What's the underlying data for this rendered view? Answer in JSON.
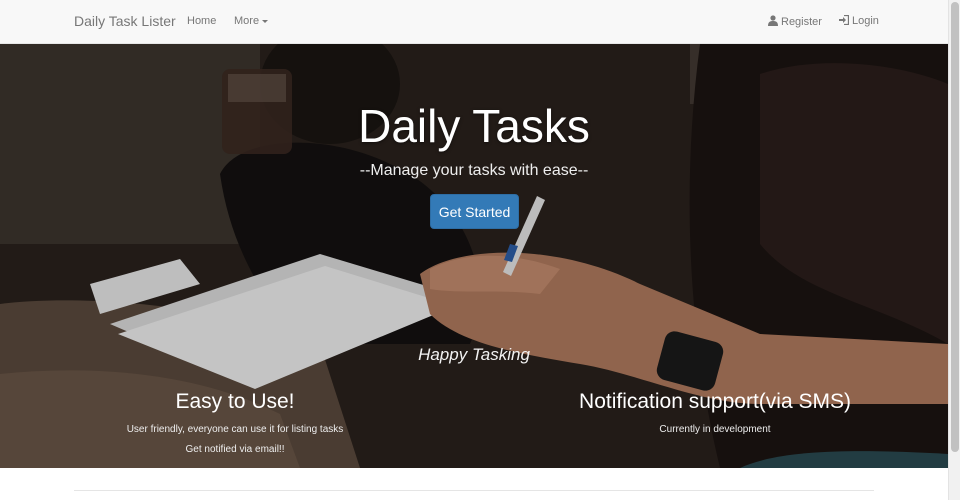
{
  "navbar": {
    "brand": "Daily Task Lister",
    "home": "Home",
    "more": "More",
    "register": "Register",
    "login": "Login"
  },
  "hero": {
    "title": "Daily Tasks",
    "subtitle": "--Manage your tasks with ease--",
    "cta": "Get Started",
    "tagline": "Happy Tasking"
  },
  "features": [
    {
      "title": "Easy to Use!",
      "lines": [
        "User friendly, everyone can use it for listing tasks",
        "Get notified via email!!"
      ]
    },
    {
      "title": "Notification support(via SMS)",
      "lines": [
        "Currently in development"
      ]
    }
  ],
  "colors": {
    "primary": "#337ab7",
    "navbar_bg": "#f8f8f8",
    "nav_text": "#777777"
  },
  "icons": {
    "register": "user-icon",
    "login": "login-icon",
    "more": "caret-down-icon"
  }
}
